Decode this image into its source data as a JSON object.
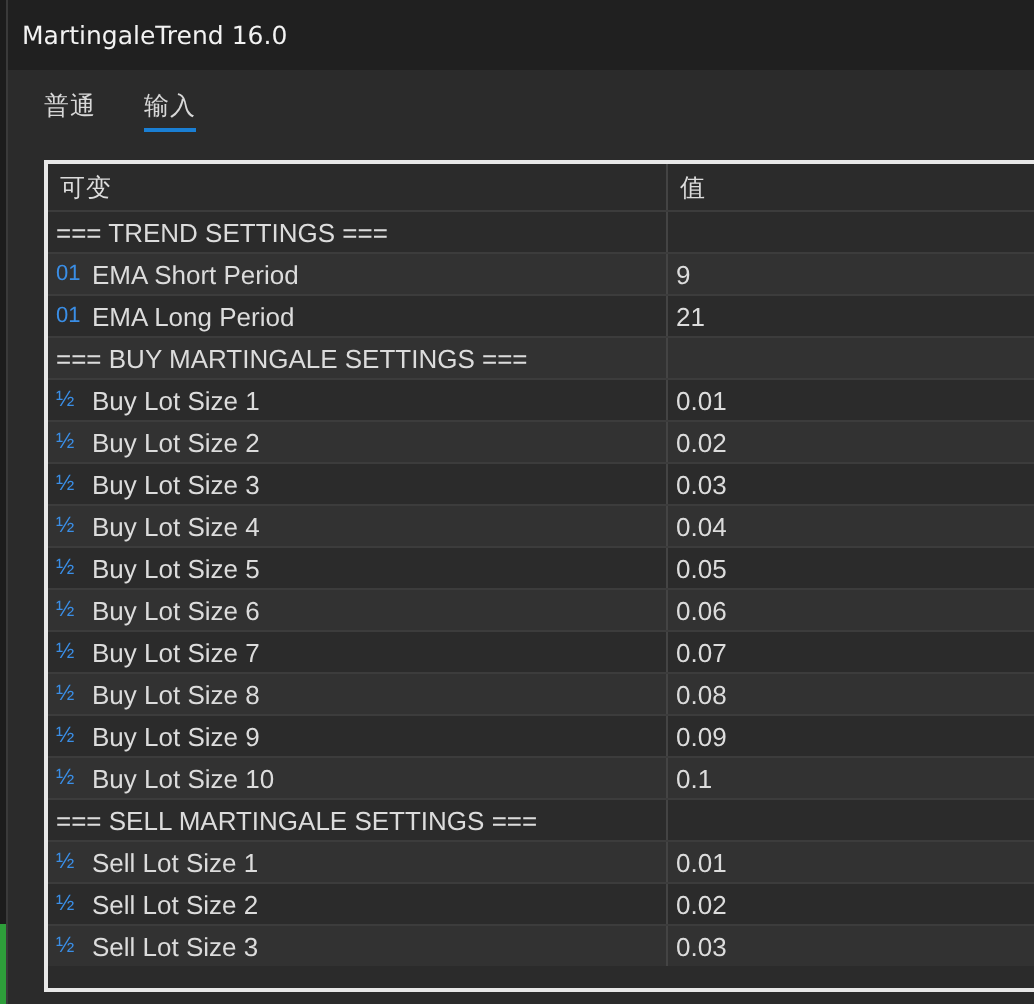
{
  "window": {
    "title": "MartingaleTrend 16.0"
  },
  "tabs": [
    {
      "label": "普通",
      "selected": false
    },
    {
      "label": "输入",
      "selected": true
    }
  ],
  "table": {
    "columns": [
      "可变",
      "值"
    ],
    "rows": [
      {
        "kind": "group",
        "name": "=== TREND SETTINGS ==="
      },
      {
        "kind": "param",
        "icon": "01",
        "name": "EMA Short Period",
        "value": "9"
      },
      {
        "kind": "param",
        "icon": "01",
        "name": "EMA Long Period",
        "value": "21"
      },
      {
        "kind": "group",
        "name": "=== BUY MARTINGALE SETTINGS ==="
      },
      {
        "kind": "param",
        "icon": "½",
        "name": "Buy Lot Size 1",
        "value": "0.01"
      },
      {
        "kind": "param",
        "icon": "½",
        "name": "Buy Lot Size 2",
        "value": "0.02"
      },
      {
        "kind": "param",
        "icon": "½",
        "name": "Buy Lot Size 3",
        "value": "0.03"
      },
      {
        "kind": "param",
        "icon": "½",
        "name": "Buy Lot Size 4",
        "value": "0.04"
      },
      {
        "kind": "param",
        "icon": "½",
        "name": "Buy Lot Size 5",
        "value": "0.05"
      },
      {
        "kind": "param",
        "icon": "½",
        "name": "Buy Lot Size 6",
        "value": "0.06"
      },
      {
        "kind": "param",
        "icon": "½",
        "name": "Buy Lot Size 7",
        "value": "0.07"
      },
      {
        "kind": "param",
        "icon": "½",
        "name": "Buy Lot Size 8",
        "value": "0.08"
      },
      {
        "kind": "param",
        "icon": "½",
        "name": "Buy Lot Size 9",
        "value": "0.09"
      },
      {
        "kind": "param",
        "icon": "½",
        "name": "Buy Lot Size 10",
        "value": "0.1"
      },
      {
        "kind": "group",
        "name": "=== SELL MARTINGALE SETTINGS ==="
      },
      {
        "kind": "param",
        "icon": "½",
        "name": "Sell Lot Size 1",
        "value": "0.01"
      },
      {
        "kind": "param",
        "icon": "½",
        "name": "Sell Lot Size 2",
        "value": "0.02"
      },
      {
        "kind": "param",
        "icon": "½",
        "name": "Sell Lot Size 3",
        "value": "0.03"
      }
    ]
  }
}
